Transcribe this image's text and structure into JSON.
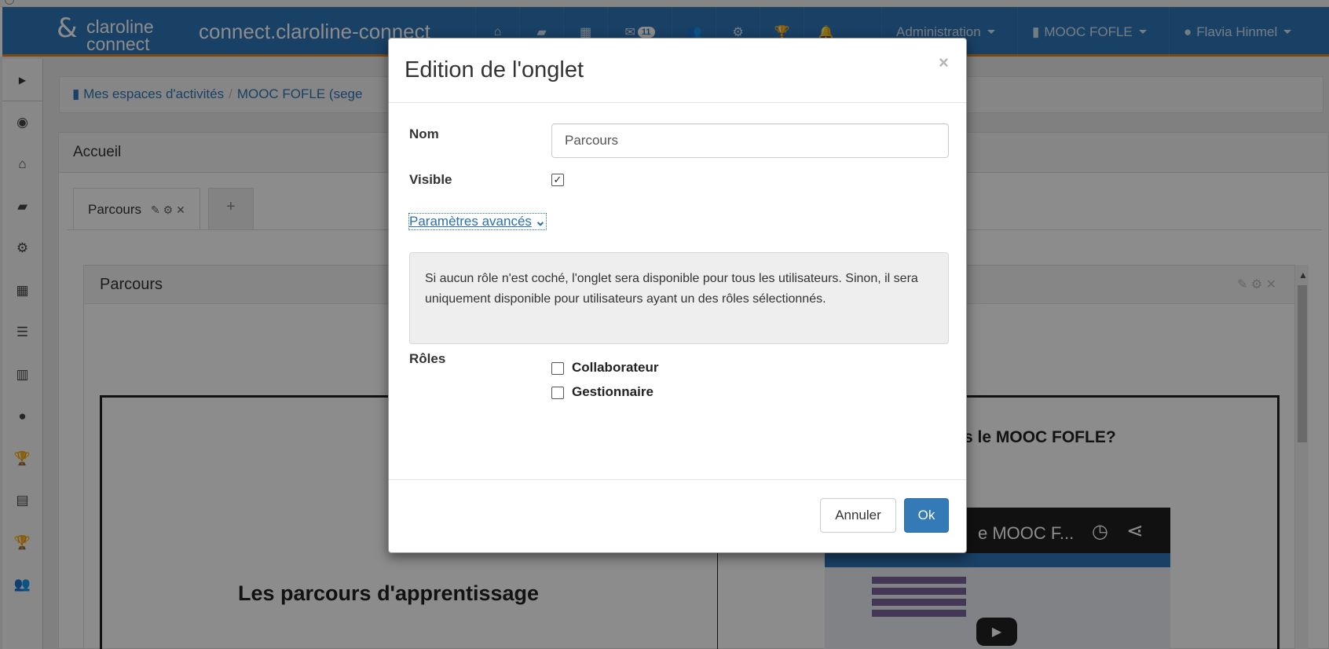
{
  "navbar": {
    "logo_line1": "claroline",
    "logo_line2": "connect",
    "site_title": "connect.claroline-connect",
    "mail_count": "11",
    "admin_menu": "Administration",
    "workspace_menu": "MOOC FOFLE",
    "user_menu": "Flavia Hinmel"
  },
  "breadcrumb": {
    "item1": "Mes espaces d'activités",
    "item2": "MOOC FOFLE (sege"
  },
  "home_panel": {
    "title": "Accueil",
    "tab_label": "Parcours",
    "add_tab": "+"
  },
  "parcours_panel": {
    "title": "Parcours",
    "cell_title": "Les parcours d'apprentissage",
    "cell_question": "s le MOOC FOFLE?",
    "video_title": "e MOOC F..."
  },
  "modal": {
    "title": "Edition de l'onglet",
    "close": "×",
    "name_label": "Nom",
    "name_value": "Parcours",
    "visible_label": "Visible",
    "visible_checked": true,
    "advanced_link": "Paramètres avancés",
    "info_text": "Si aucun rôle n'est coché, l'onglet sera disponible pour tous les utilisateurs. Sinon, il sera uniquement disponible pour utilisateurs ayant un des rôles sélectionnés.",
    "roles_label": "Rôles",
    "roles": [
      {
        "label": "Collaborateur",
        "checked": false
      },
      {
        "label": "Gestionnaire",
        "checked": false
      }
    ],
    "cancel_label": "Annuler",
    "ok_label": "Ok"
  },
  "colors": {
    "navbar": "#2f76b8",
    "navbar_border": "#e0861f",
    "primary_button": "#337ab7"
  }
}
